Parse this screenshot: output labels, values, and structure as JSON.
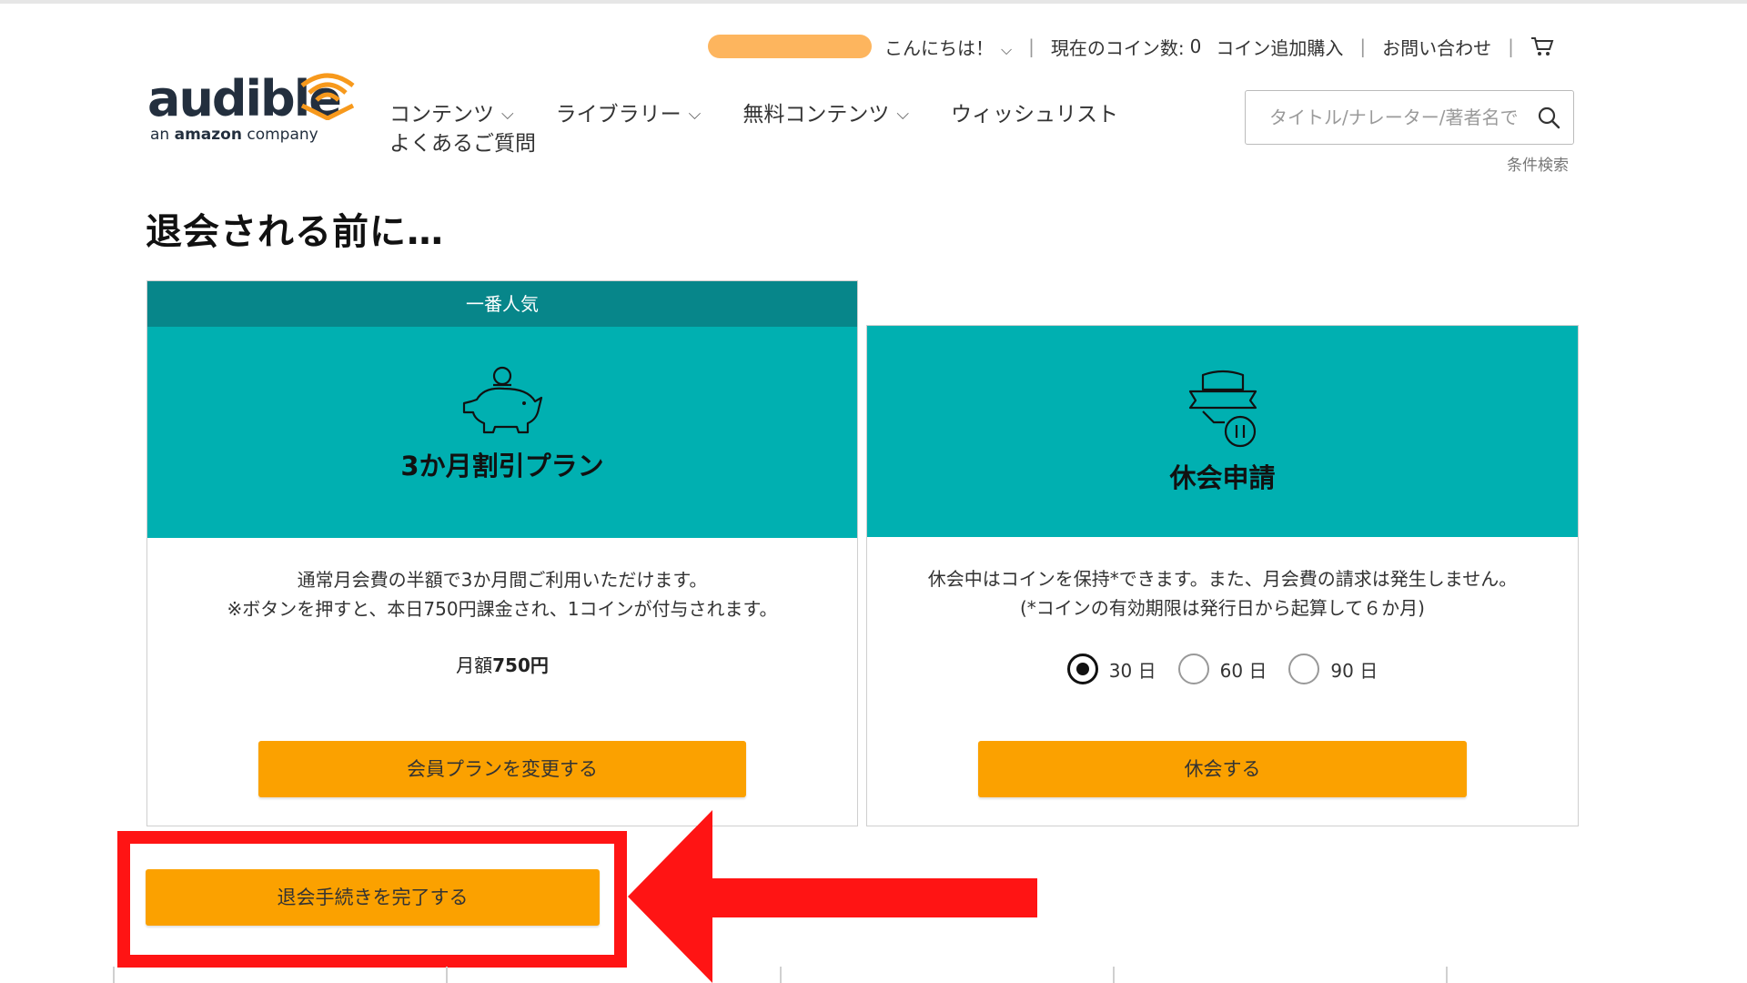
{
  "header": {
    "greeting": "こんにちは！",
    "coin_label": "現在のコイン数:",
    "coin_count": "0",
    "buy_coins": "コイン追加購入",
    "contact": "お問い合わせ"
  },
  "logo": {
    "word": "audible",
    "sub_prefix": "an ",
    "sub_brand": "amazon",
    "sub_suffix": " company"
  },
  "nav": {
    "items": [
      {
        "label": "コンテンツ",
        "has_menu": true
      },
      {
        "label": "ライブラリー",
        "has_menu": true
      },
      {
        "label": "無料コンテンツ",
        "has_menu": true
      },
      {
        "label": "ウィッシュリスト",
        "has_menu": false
      },
      {
        "label": "よくあるご質問",
        "has_menu": false
      }
    ]
  },
  "search": {
    "placeholder": "タイトル/ナレーター/著者名で",
    "advanced": "条件検索"
  },
  "page_title": "退会される前に…",
  "plans": {
    "discount": {
      "badge": "一番人気",
      "title": "3か月割引プラン",
      "desc_line1": "通常月会費の半額で3か月間ご利用いただけます。",
      "desc_line2": "※ボタンを押すと、本日750円課金され、1コインが付与されます。",
      "price_prefix": "月額",
      "price_value": "750円",
      "button": "会員プランを変更する"
    },
    "pause": {
      "title": "休会申請",
      "desc_line1": "休会中はコインを保持*できます。また、月会費の請求は発生しません。",
      "desc_line2": "(*コインの有効期限は発行日から起算して６か月)",
      "options": [
        "30 日",
        "60 日",
        "90 日"
      ],
      "selected": "30 日",
      "button": "休会する"
    }
  },
  "cancel_button": "退会手続きを完了する",
  "colors": {
    "teal": "#00b0b1",
    "teal_dark": "#07868a",
    "button_orange": "#fba100",
    "highlight_red": "#ff1414",
    "name_mask": "#fdb55e"
  }
}
